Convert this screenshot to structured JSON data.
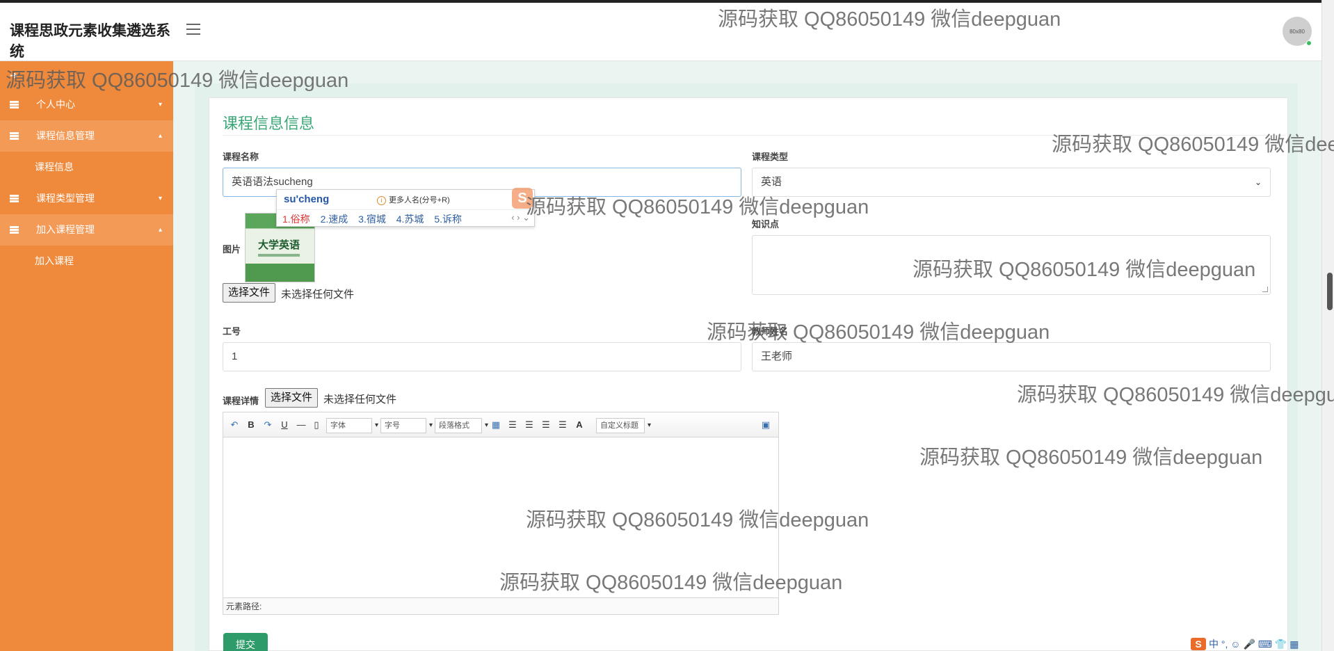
{
  "app": {
    "title": "课程思政元素收集遴选系统"
  },
  "header": {
    "avatar_text": "80x80"
  },
  "sidebar": {
    "items": [
      {
        "label": "个人中心",
        "caret": "▾"
      },
      {
        "label": "课程信息管理",
        "caret": "▴",
        "sub": [
          "课程信息"
        ]
      },
      {
        "label": "课程类型管理",
        "caret": "▾"
      },
      {
        "label": "加入课程管理",
        "caret": "▴",
        "sub": [
          "加入课程"
        ]
      }
    ]
  },
  "form": {
    "title": "课程信息信息",
    "course_name": {
      "label": "课程名称",
      "value": "英语语法sucheng"
    },
    "course_type": {
      "label": "课程类型",
      "value": "英语"
    },
    "image": {
      "label": "图片",
      "cover_text": "大学英语"
    },
    "knowledge": {
      "label": "知识点"
    },
    "file_button": "选择文件",
    "no_file_text": "未选择任何文件",
    "work_no": {
      "label": "工号",
      "value": "1"
    },
    "teacher_name": {
      "label": "教师姓名",
      "value": "王老师"
    },
    "detail": {
      "label": "课程详情"
    },
    "submit": "提交"
  },
  "ime": {
    "pinyin": "su'cheng",
    "more": "更多人名(分号+R)",
    "candidates": [
      "1.俗称",
      "2.速成",
      "3.宿城",
      "4.苏城",
      "5.诉称"
    ],
    "nav": "‹ › ⌄"
  },
  "editor": {
    "font_family": "字体",
    "font_size": "字号",
    "paragraph": "段落格式",
    "custom_title": "自定义标题",
    "status": "元素路径:"
  },
  "watermark": "源码获取 QQ86050149 微信deepguan",
  "imebar": "中 °, ☺ 🎤 ⌨ 👕 ▦"
}
